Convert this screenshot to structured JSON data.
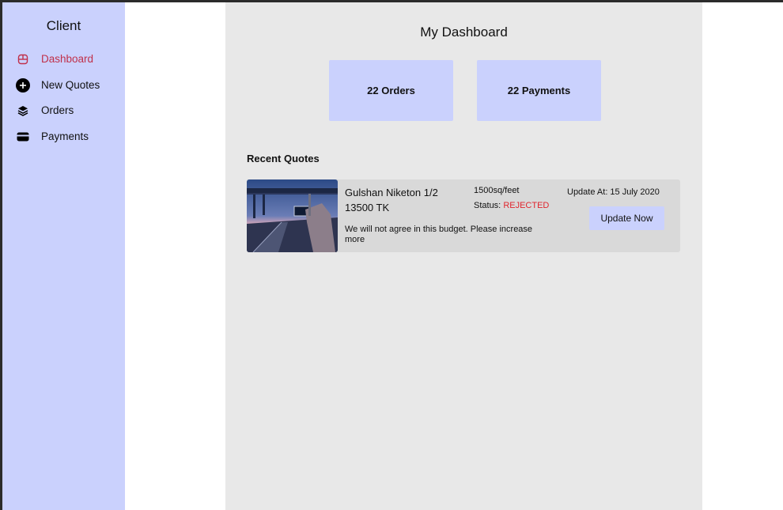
{
  "sidebar": {
    "title": "Client",
    "items": [
      {
        "label": "Dashboard",
        "icon": "dashboard-icon",
        "active": true
      },
      {
        "label": "New Quotes",
        "icon": "plus-circle-icon"
      },
      {
        "label": "Orders",
        "icon": "layers-icon"
      },
      {
        "label": "Payments",
        "icon": "card-icon"
      }
    ]
  },
  "main": {
    "title": "My Dashboard",
    "stats": {
      "orders": "22 Orders",
      "payments": "22 Payments"
    },
    "recent_title": "Recent Quotes",
    "quote": {
      "name": "Gulshan Niketon 1/2",
      "price": "13500 TK",
      "note": "We will not agree in this budget. Please increase more",
      "area": "1500sq/feet",
      "status_label": "Status:",
      "status_value": "REJECTED",
      "updated": "Update At: 15 July 2020",
      "button": "Update Now"
    }
  },
  "colors": {
    "sidebar_bg": "#cad1fd",
    "main_bg": "#e8e8e8",
    "card_bg": "#d9d9d9",
    "active": "#c0304a",
    "rejected": "#e0262e"
  }
}
